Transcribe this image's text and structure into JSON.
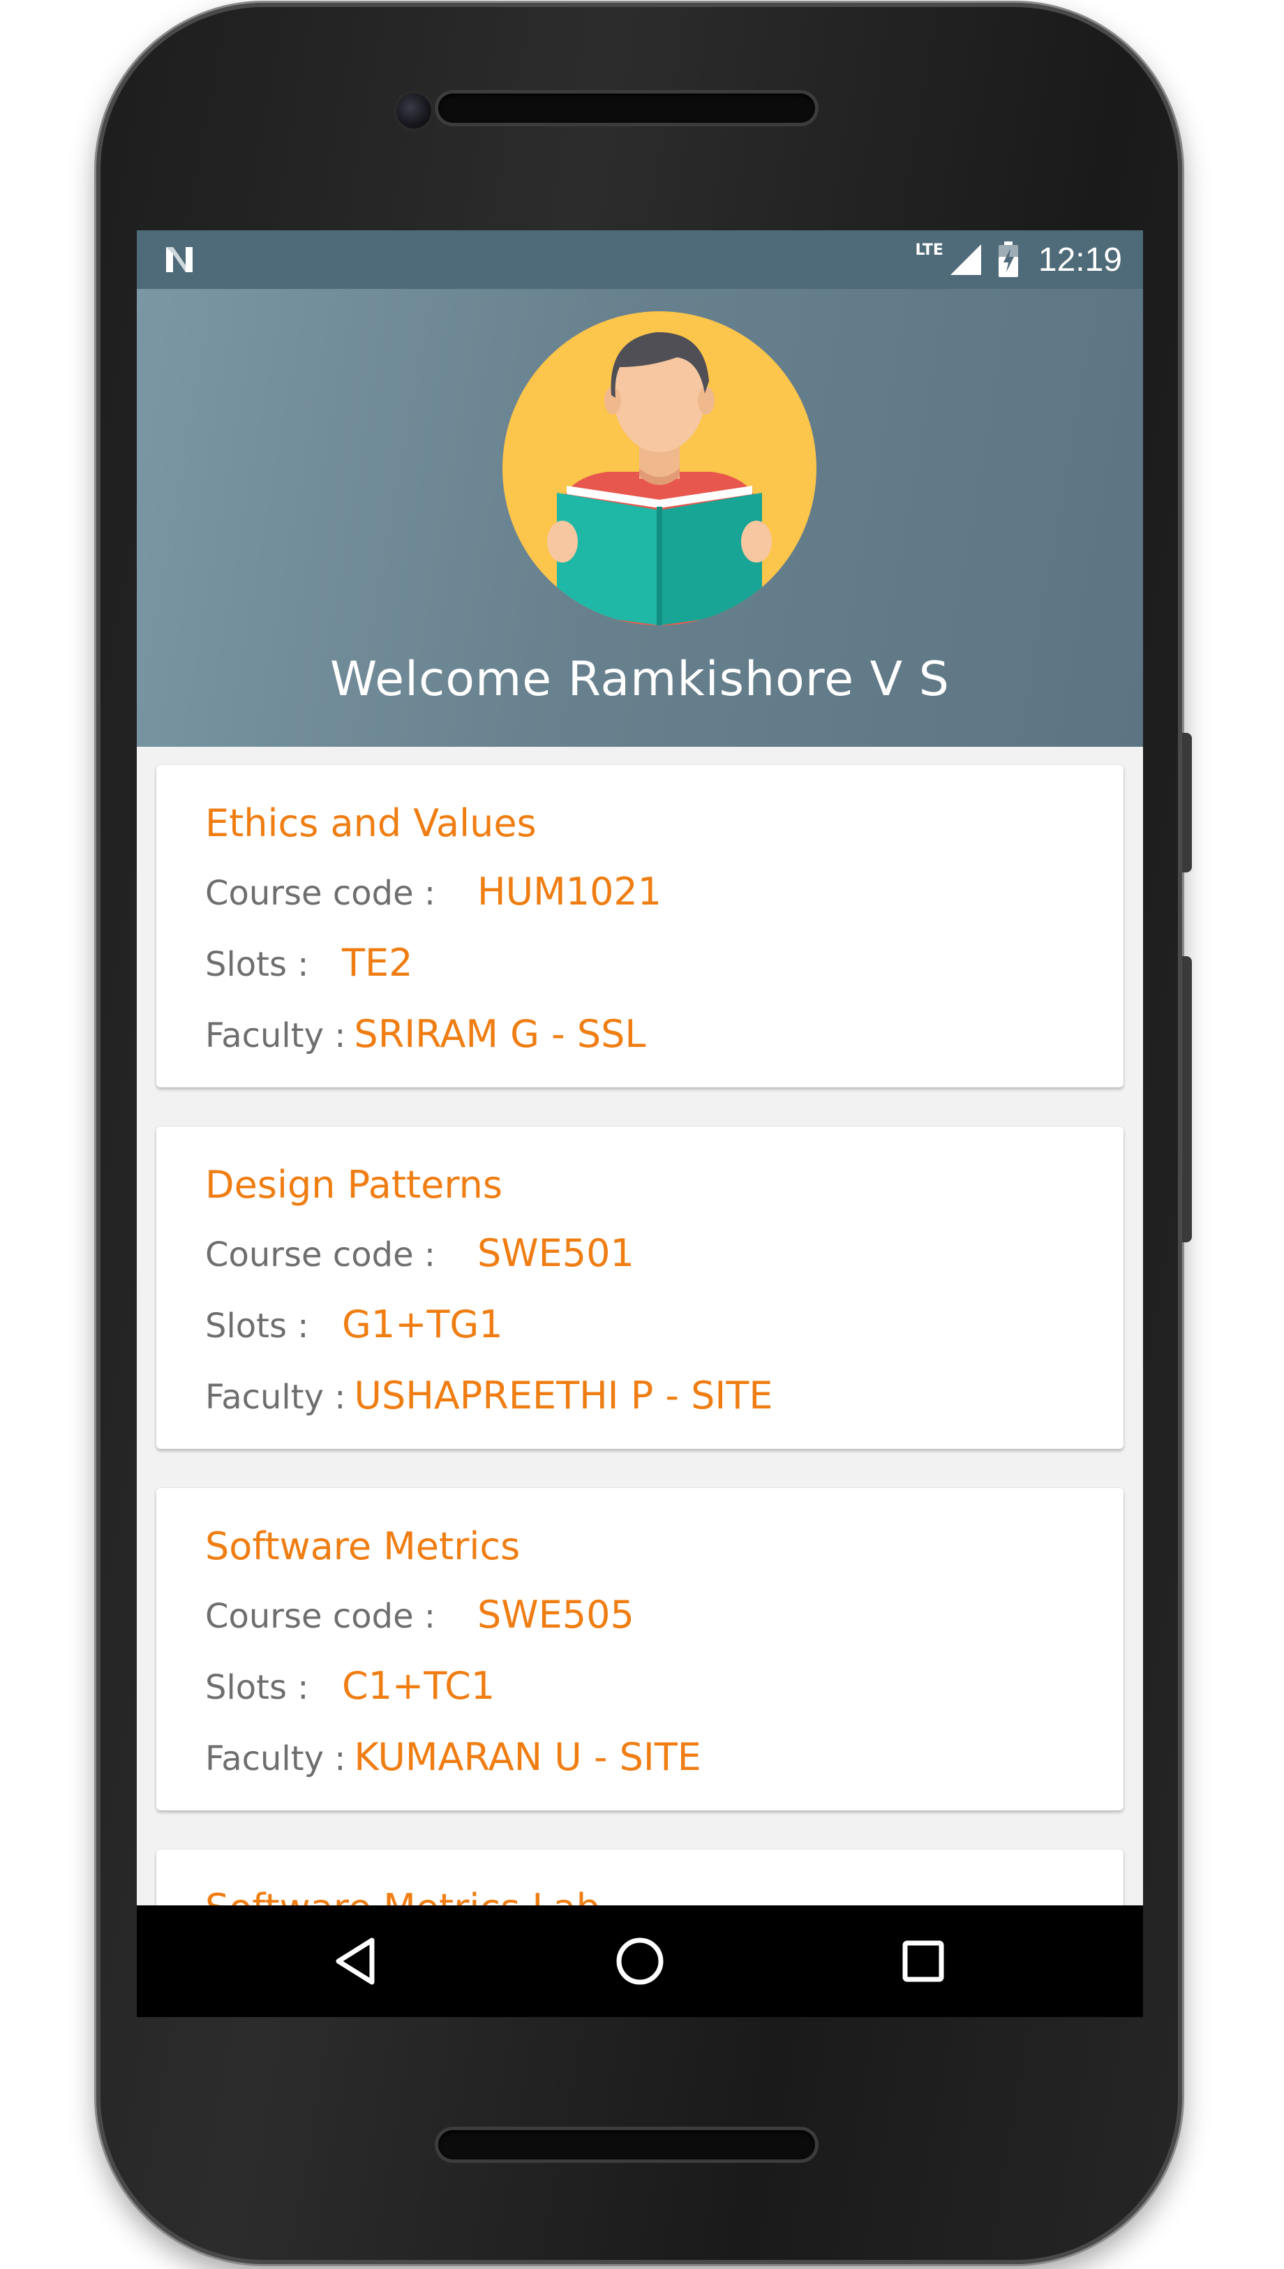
{
  "status_bar": {
    "left_icon": "n-logo-icon",
    "network": "LTE",
    "signal_icon": "signal-icon",
    "battery_icon": "battery-charging-icon",
    "time": "12:19"
  },
  "header": {
    "avatar_icon": "student-reading-icon",
    "welcome_text": "Welcome Ramkishore V S"
  },
  "labels": {
    "course_code": "Course code :",
    "slots": "Slots :",
    "faculty": "Faculty :"
  },
  "courses": [
    {
      "title": "Ethics and Values",
      "code": "HUM1021",
      "slots": "TE2",
      "faculty": "SRIRAM G - SSL"
    },
    {
      "title": "Design Patterns",
      "code": "SWE501",
      "slots": "G1+TG1",
      "faculty": "USHAPREETHI P - SITE"
    },
    {
      "title": "Software Metrics",
      "code": "SWE505",
      "slots": "C1+TC1",
      "faculty": "KUMARAN U - SITE"
    },
    {
      "title": "Software Metrics Lab"
    }
  ],
  "nav_bar": {
    "back_icon": "back-triangle-icon",
    "home_icon": "home-circle-icon",
    "recents_icon": "recents-square-icon"
  },
  "colors": {
    "accent": "#ef7d12",
    "header": "#68818e",
    "status_bar": "#4f6a78",
    "label": "#6e6e6e"
  }
}
